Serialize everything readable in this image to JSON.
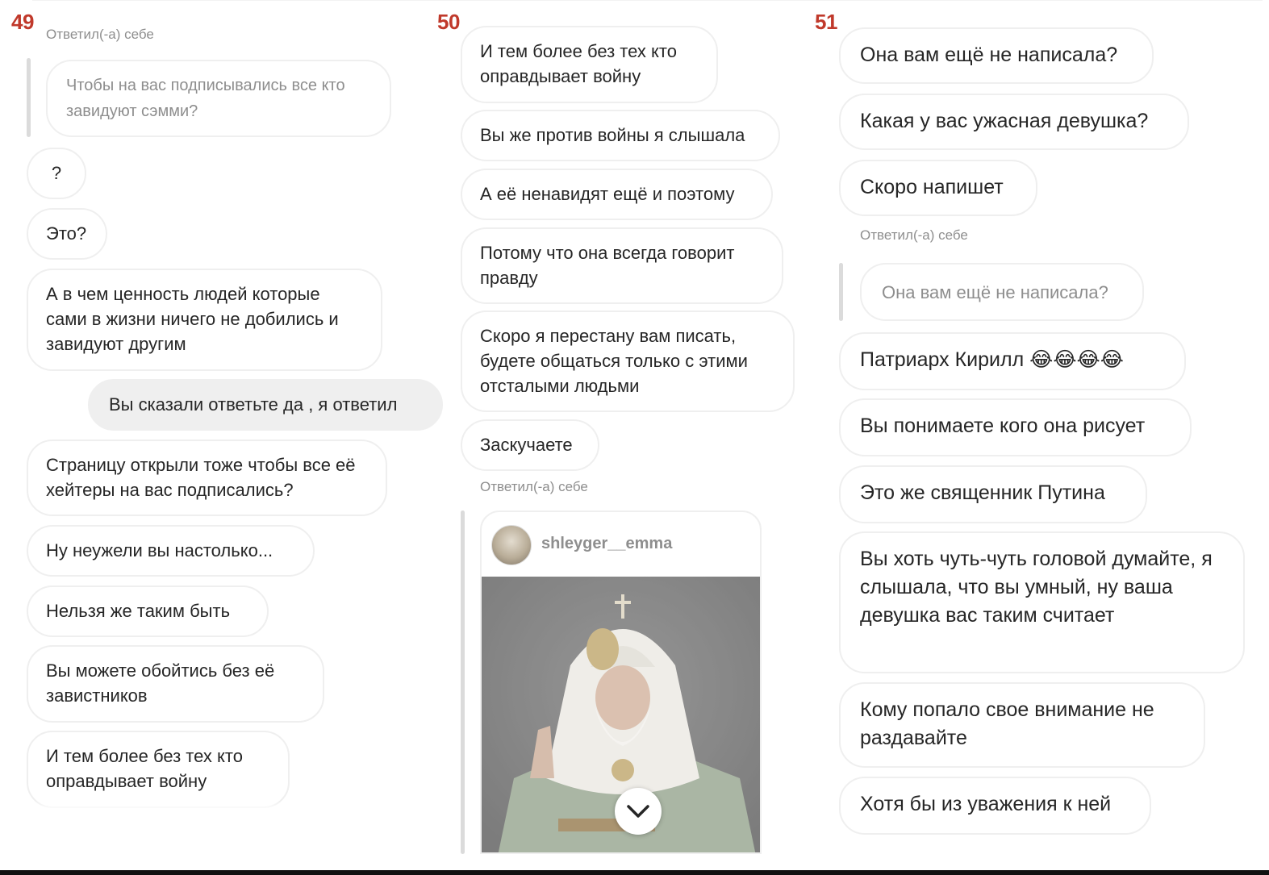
{
  "panels": [
    {
      "number": "49",
      "reply_label": "Ответил(-а) себе",
      "quoted": "Чтобы на вас подписывались все кто завидуют сэмми?",
      "messages": [
        "?",
        "Это?",
        "А в чем ценность людей которые сами в жизни ничего не добились и завидуют другим",
        "Вы сказали ответьте да , я ответил",
        "Страницу открыли тоже чтобы все её хейтеры на вас подписались?",
        "Ну неужели вы настолько...",
        "Нельзя же таким быть",
        "Вы можете обойтись без её завистников",
        "И тем более без тех кто оправдывает войну"
      ]
    },
    {
      "number": "50",
      "messages": [
        "И тем более без тех кто оправдывает войну",
        "Вы же против войны я слышала",
        "А её ненавидят ещё и поэтому",
        "Потому что она всегда говорит правду",
        "Скоро я перестану вам писать, будете общаться только с этими отсталыми людьми",
        "Заскучаете"
      ],
      "reply_label": "Ответил(-а) себе",
      "post": {
        "username": "shleyger__emma",
        "image": "portrait-of-patriarch-icon"
      }
    },
    {
      "number": "51",
      "messages_before": [
        "Она вам ещё не написала?",
        "Какая у вас ужасная девушка?",
        "Скоро напишет"
      ],
      "reply_label": "Ответил(-а) себе",
      "quoted": "Она вам ещё не написала?",
      "messages_after": [
        "Патриарх Кирилл 😂😂😂😂",
        "Вы понимаете кого она рисует",
        "Это же священник Путина",
        "Вы хоть чуть-чуть головой думайте, я слышала, что вы умный, ну ваша девушка вас таким считает",
        "Кому попало свое внимание не раздавайте",
        "Хотя бы из уважения к ней"
      ]
    }
  ],
  "colors": {
    "number": "#c0392b",
    "bubble_border": "#efefef",
    "own_bubble": "#efefef",
    "muted_text": "#8e8e8e"
  }
}
